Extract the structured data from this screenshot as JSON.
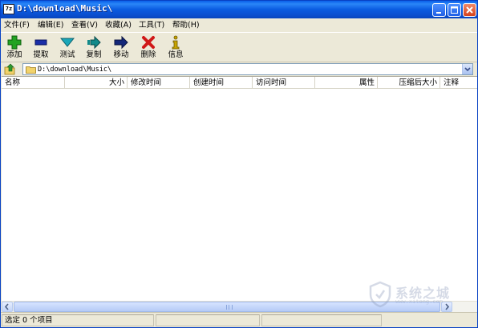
{
  "window": {
    "title": "D:\\download\\Music\\",
    "app_icon_text": "7z"
  },
  "menu": [
    {
      "label": "文件(F)"
    },
    {
      "label": "编辑(E)"
    },
    {
      "label": "查看(V)"
    },
    {
      "label": "收藏(A)"
    },
    {
      "label": "工具(T)"
    },
    {
      "label": "帮助(H)"
    }
  ],
  "toolbar": [
    {
      "label": "添加",
      "icon": "plus-icon",
      "color": "#22a322"
    },
    {
      "label": "提取",
      "icon": "minus-icon",
      "color": "#1a2ea8"
    },
    {
      "label": "测试",
      "icon": "check-down-icon",
      "color": "#1aa6b8"
    },
    {
      "label": "复制",
      "icon": "copy-arrow-icon",
      "color": "#128a8a"
    },
    {
      "label": "移动",
      "icon": "move-arrow-icon",
      "color": "#14287a"
    },
    {
      "label": "删除",
      "icon": "delete-x-icon",
      "color": "#d01818"
    },
    {
      "label": "信息",
      "icon": "info-icon",
      "color": "#c8a400"
    }
  ],
  "address": {
    "path": "D:\\download\\Music\\"
  },
  "columns": [
    {
      "label": "名称"
    },
    {
      "label": "大小"
    },
    {
      "label": "修改时间"
    },
    {
      "label": "创建时间"
    },
    {
      "label": "访问时间"
    },
    {
      "label": "属性"
    },
    {
      "label": "压缩后大小"
    },
    {
      "label": "注释"
    }
  ],
  "status": {
    "selection": "选定 0 个项目"
  },
  "watermark": {
    "text": "系统之城",
    "url": "www.xitong.com"
  }
}
